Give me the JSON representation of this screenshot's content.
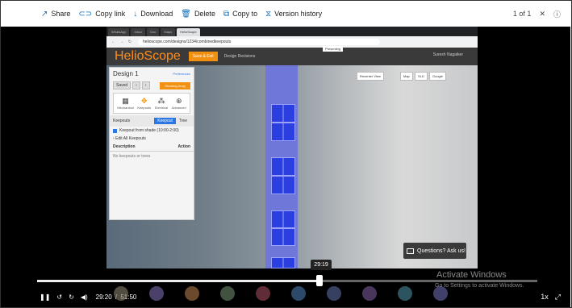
{
  "viewer_toolbar": {
    "share": "Share",
    "copy_link": "Copy link",
    "download": "Download",
    "delete": "Delete",
    "copy_to": "Copy to",
    "version_history": "Version history",
    "page_count": "1 of 1"
  },
  "browser": {
    "url": "helioscope.com/designs/1234/combinedkeepouts",
    "presenting": "Presenting"
  },
  "app": {
    "logo": "HelioScope",
    "save_exit": "Save & Exit",
    "design_revisions": "Design Revisions",
    "user": "Suresh Nagaiker"
  },
  "design_panel": {
    "title": "Design 1",
    "preferences": "Preferences",
    "saved": "Saved",
    "showing_array": "Showing Array",
    "tools": [
      "Mechanical",
      "Keepouts",
      "Electrical",
      "Advanced"
    ],
    "keepouts_label": "Keepouts",
    "tab_keepout": "Keepout",
    "tab_tree": "Tree",
    "keepout_from_shade": "Keepout from shade (10:00-2:00)",
    "edit_all": "Edit All Keepouts",
    "col_description": "Description",
    "col_action": "Action",
    "empty": "No keepouts or trees"
  },
  "map_controls": {
    "recenter": "Recenter View",
    "map": "Map",
    "sld": "SLD",
    "google": "Google"
  },
  "questions": "Questions? Ask us!",
  "watermark": {
    "line1": "Activate Windows",
    "line2": "Go to Settings to activate Windows."
  },
  "player": {
    "hover_time": "29:19",
    "current_time": "29:20",
    "total_time": "51:50",
    "progress": 0.565,
    "speed": "1x"
  }
}
